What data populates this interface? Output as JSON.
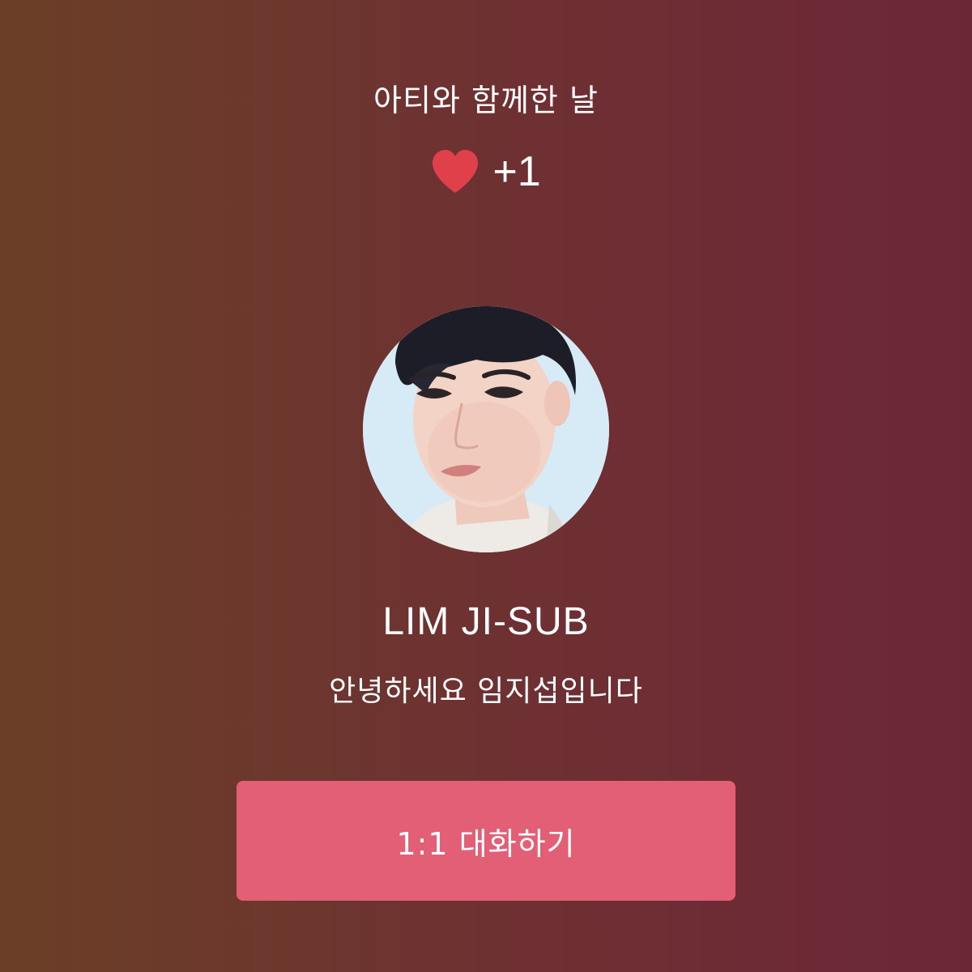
{
  "header": {
    "title": "아티와 함께한 날"
  },
  "reward": {
    "icon": "heart-icon",
    "icon_color": "#e0404a",
    "count": "+1"
  },
  "profile": {
    "avatar_alt": "LIM JI-SUB",
    "name": "LIM JI-SUB",
    "greeting": "안녕하세요 임지섭입니다"
  },
  "actions": {
    "chat_label": "1:1 대화하기",
    "chat_color": "#e25f76"
  },
  "theme": {
    "bg_left": "#6b3f27",
    "bg_right": "#6c2737",
    "text": "#ffffff"
  }
}
